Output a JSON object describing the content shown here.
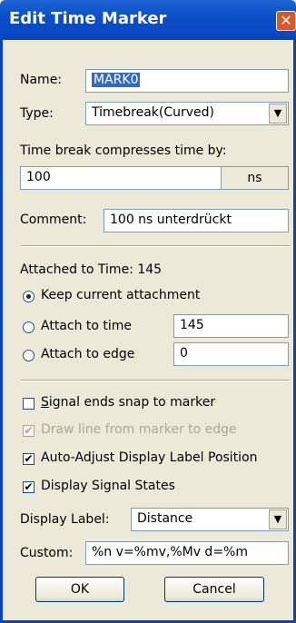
{
  "window": {
    "title": "Edit Time Marker",
    "close_glyph": "✕"
  },
  "name": {
    "label": "Name:",
    "value": "MARK0"
  },
  "type": {
    "label": "Type:",
    "value": "Timebreak(Curved)"
  },
  "compress": {
    "label": "Time break compresses time by:",
    "value": "100",
    "unit": "ns"
  },
  "comment": {
    "label": "Comment:",
    "value": "100 ns unterdrückt"
  },
  "attached": {
    "label": "Attached to Time: 145",
    "options": [
      {
        "label": "Keep current attachment",
        "selected": true
      },
      {
        "label": "Attach to time",
        "value": "145",
        "selected": false
      },
      {
        "label": "Attach to edge",
        "value": "0",
        "selected": false
      }
    ]
  },
  "checks": {
    "snap": {
      "label_first": "S",
      "label_rest": "ignal ends snap to marker",
      "checked": false
    },
    "drawline": {
      "label": "Draw line from marker to edge",
      "checked": true,
      "disabled": true
    },
    "autoadjust": {
      "label": "Auto-Adjust Display Label Position",
      "checked": true
    },
    "signalstates": {
      "label": "Display Signal States",
      "checked": true
    }
  },
  "display_label": {
    "label": "Display Label:",
    "value": "Distance"
  },
  "custom": {
    "label": "Custom:",
    "value": "%n v=%mv,%Mv d=%m"
  },
  "buttons": {
    "ok": "OK",
    "cancel": "Cancel"
  },
  "icons": {
    "dropdown": "▼",
    "check": "✔"
  }
}
